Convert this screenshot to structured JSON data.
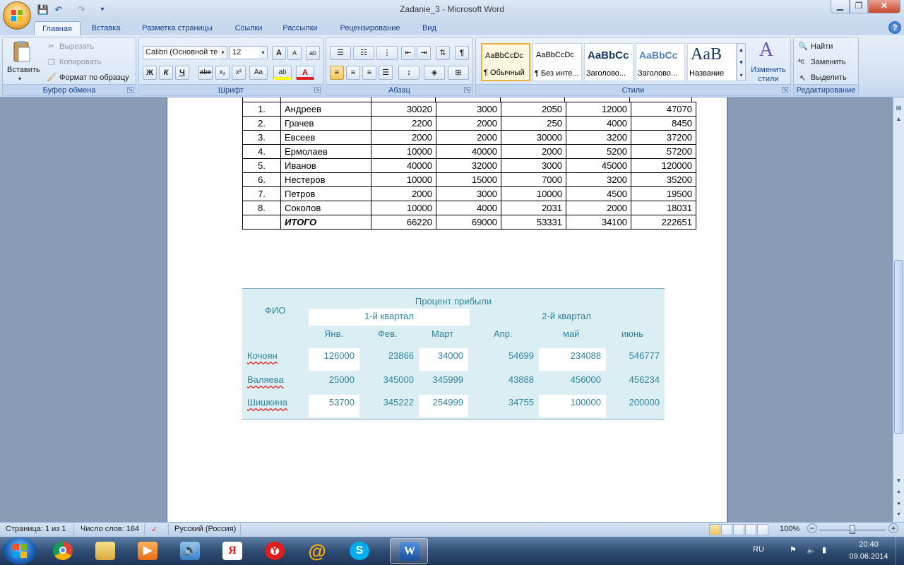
{
  "window": {
    "title": "Zadanie_3 - Microsoft Word"
  },
  "qat": {
    "save": "💾",
    "undo": "↶",
    "redo": "↷",
    "customize": "▾"
  },
  "tabs": [
    "Главная",
    "Вставка",
    "Разметка страницы",
    "Ссылки",
    "Рассылки",
    "Рецензирование",
    "Вид"
  ],
  "ribbon": {
    "clipboard": {
      "label": "Буфер обмена",
      "paste": "Вставить",
      "cut": "Вырезать",
      "copy": "Копировать",
      "format_painter": "Формат по образцу"
    },
    "font": {
      "label": "Шрифт",
      "font_name": "Calibri (Основной те",
      "font_size": "12",
      "bold": "Ж",
      "italic": "К",
      "underline": "Ч",
      "strike": "abe",
      "sub": "x₂",
      "sup": "x²",
      "case": "Aa",
      "grow": "A",
      "shrink": "A",
      "highlight": "ab",
      "color": "A"
    },
    "paragraph": {
      "label": "Абзац",
      "pilcrow": "¶"
    },
    "styles": {
      "label": "Стили",
      "cards": [
        {
          "sample": "AaBbCcDc",
          "name": "¶ Обычный"
        },
        {
          "sample": "AaBbCcDc",
          "name": "¶ Без инте..."
        },
        {
          "sample": "AaBbCc",
          "name": "Заголово..."
        },
        {
          "sample": "AaBbCc",
          "name": "Заголово..."
        },
        {
          "sample": "AaB",
          "name": "Название"
        }
      ],
      "change_styles": "Изменить стили"
    },
    "editing": {
      "label": "Редактирование",
      "find": "Найти",
      "replace": "Заменить",
      "select": "Выделить"
    }
  },
  "table1": {
    "rows": [
      {
        "n": "1.",
        "name": "Андреев",
        "v": [
          "30020",
          "3000",
          "2050",
          "12000",
          "47070"
        ]
      },
      {
        "n": "2.",
        "name": "Грачев",
        "v": [
          "2200",
          "2000",
          "250",
          "4000",
          "8450"
        ]
      },
      {
        "n": "3.",
        "name": "Евсеев",
        "v": [
          "2000",
          "2000",
          "30000",
          "3200",
          "37200"
        ]
      },
      {
        "n": "4.",
        "name": "Ермолаев",
        "v": [
          "10000",
          "40000",
          "2000",
          "5200",
          "57200"
        ]
      },
      {
        "n": "5.",
        "name": "Иванов",
        "v": [
          "40000",
          "32000",
          "3000",
          "45000",
          "120000"
        ]
      },
      {
        "n": "6.",
        "name": "Нестеров",
        "v": [
          "10000",
          "15000",
          "7000",
          "3200",
          "35200"
        ]
      },
      {
        "n": "7.",
        "name": "Петров",
        "v": [
          "2000",
          "3000",
          "10000",
          "4500",
          "19500"
        ]
      },
      {
        "n": "8.",
        "name": "Соколов",
        "v": [
          "10000",
          "4000",
          "2031",
          "2000",
          "18031"
        ]
      }
    ],
    "total": {
      "label": "ИТОГО",
      "v": [
        "66220",
        "69000",
        "53331",
        "34100",
        "222651"
      ]
    }
  },
  "table2": {
    "header": "Процент прибыли",
    "fio": "ФИО",
    "q1": "1-й квартал",
    "q2": "2-й квартал",
    "months": [
      "Янв.",
      "Фев.",
      "Март",
      "Апр.",
      "май",
      "июнь"
    ],
    "rows": [
      {
        "name": "Кочоян",
        "v": [
          "126000",
          "23866",
          "34000",
          "54699",
          "234088",
          "546777"
        ]
      },
      {
        "name": "Валяева",
        "v": [
          "25000",
          "345000",
          "345999",
          "43888",
          "456000",
          "456234"
        ]
      },
      {
        "name": "Шишкина",
        "v": [
          "53700",
          "345222",
          "254999",
          "34755",
          "100000",
          "200000"
        ]
      }
    ]
  },
  "status": {
    "page": "Страница: 1 из 1",
    "words": "Число слов: 164",
    "language": "Русский (Россия)",
    "zoom": "100%",
    "minus": "−",
    "plus": "+"
  },
  "taskbar": {
    "apps": [
      "chrome-icon",
      "explorer-icon",
      "media-player-icon",
      "audio-icon",
      "yandex-icon",
      "yandex-browser-icon",
      "mail-agent-icon",
      "skype-icon",
      "word-icon"
    ],
    "lang": "RU",
    "time": "20:40",
    "date": "09.06.2014"
  }
}
